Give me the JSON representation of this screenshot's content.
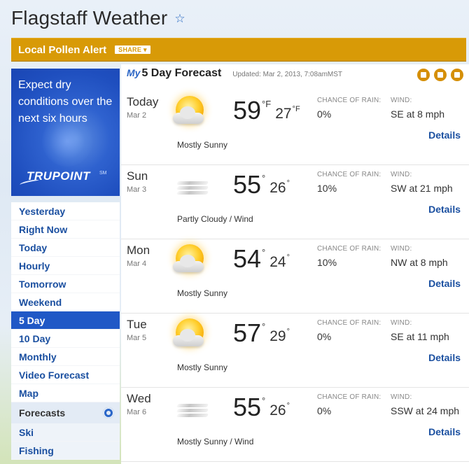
{
  "page": {
    "title": "Flagstaff Weather",
    "star_icon": "star-outline-icon"
  },
  "pollen": {
    "title": "Local Pollen Alert",
    "share_label": "SHARE ▾"
  },
  "promo": {
    "text": "Expect dry conditions over the next six hours",
    "logo": "TRUPOINT",
    "logo_mark": "SM"
  },
  "nav": {
    "items": [
      {
        "label": "Yesterday",
        "active": false
      },
      {
        "label": "Right Now",
        "active": false
      },
      {
        "label": "Today",
        "active": false
      },
      {
        "label": "Hourly",
        "active": false
      },
      {
        "label": "Tomorrow",
        "active": false
      },
      {
        "label": "Weekend",
        "active": false
      },
      {
        "label": "5 Day",
        "active": true
      },
      {
        "label": "10 Day",
        "active": false
      },
      {
        "label": "Monthly",
        "active": false
      },
      {
        "label": "Video Forecast",
        "active": false
      },
      {
        "label": "Map",
        "active": false
      }
    ],
    "section_title": "Forecasts",
    "section_items": [
      "Ski",
      "Fishing"
    ]
  },
  "forecast": {
    "my_label": "My",
    "title": "5 Day Forecast",
    "updated": "Updated: Mar 2, 2013, 7:08amMST",
    "rain_label": "CHANCE OF RAIN:",
    "wind_label": "WIND:",
    "details_label": "Details",
    "days": [
      {
        "name": "Today",
        "date": "Mar 2",
        "icon": "mostly-sunny-icon",
        "condition": "Mostly Sunny",
        "hi": "59",
        "hi_unit": "°F",
        "lo": "27",
        "lo_unit": "°F",
        "rain": "0%",
        "wind": "SE at 8 mph"
      },
      {
        "name": "Sun",
        "date": "Mar 3",
        "icon": "windy-icon",
        "condition": "Partly Cloudy / Wind",
        "hi": "55",
        "hi_unit": "°",
        "lo": "26",
        "lo_unit": "°",
        "rain": "10%",
        "wind": "SW at 21 mph"
      },
      {
        "name": "Mon",
        "date": "Mar 4",
        "icon": "mostly-sunny-icon",
        "condition": "Mostly Sunny",
        "hi": "54",
        "hi_unit": "°",
        "lo": "24",
        "lo_unit": "°",
        "rain": "10%",
        "wind": "NW at 8 mph"
      },
      {
        "name": "Tue",
        "date": "Mar 5",
        "icon": "mostly-sunny-icon",
        "condition": "Mostly Sunny",
        "hi": "57",
        "hi_unit": "°",
        "lo": "29",
        "lo_unit": "°",
        "rain": "0%",
        "wind": "SE at 11 mph"
      },
      {
        "name": "Wed",
        "date": "Mar 6",
        "icon": "windy-icon",
        "condition": "Mostly Sunny / Wind",
        "hi": "55",
        "hi_unit": "°",
        "lo": "26",
        "lo_unit": "°",
        "rain": "0%",
        "wind": "SSW at 24 mph"
      }
    ]
  },
  "colors": {
    "accent": "#2058c6",
    "link": "#1a4fa0",
    "pollen_bar": "#d89a07",
    "header_icons": "#d58f08"
  }
}
